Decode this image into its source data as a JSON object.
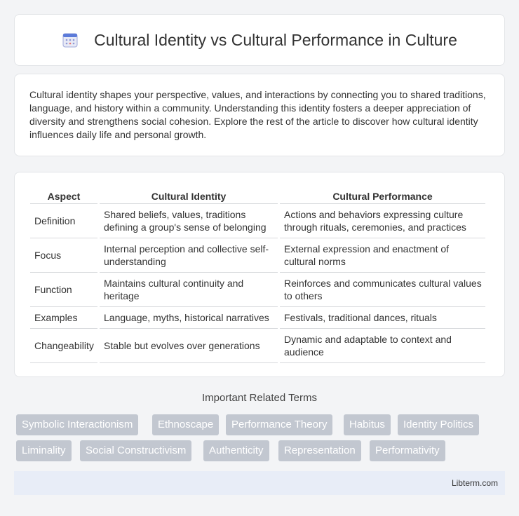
{
  "header": {
    "title": "Cultural Identity vs Cultural Performance in Culture",
    "icon": "calendar-icon"
  },
  "intro": {
    "text": "Cultural identity shapes your perspective, values, and interactions by connecting you to shared traditions, language, and history within a community. Understanding this identity fosters a deeper appreciation of diversity and strengthens social cohesion. Explore the rest of the article to discover how cultural identity influences daily life and personal growth."
  },
  "table": {
    "headers": [
      "Aspect",
      "Cultural Identity",
      "Cultural Performance"
    ],
    "rows": [
      [
        "Definition",
        "Shared beliefs, values, traditions defining a group's sense of belonging",
        "Actions and behaviors expressing culture through rituals, ceremonies, and practices"
      ],
      [
        "Focus",
        "Internal perception and collective self-understanding",
        "External expression and enactment of cultural norms"
      ],
      [
        "Function",
        "Maintains cultural continuity and heritage",
        "Reinforces and communicates cultural values to others"
      ],
      [
        "Examples",
        "Language, myths, historical narratives",
        "Festivals, traditional dances, rituals"
      ],
      [
        "Changeability",
        "Stable but evolves over generations",
        "Dynamic and adaptable to context and audience"
      ]
    ]
  },
  "related": {
    "title": "Important Related Terms",
    "tags": [
      "Symbolic Interactionism",
      "Ethnoscape",
      "Performance Theory",
      "Habitus",
      "Identity Politics",
      "Liminality",
      "Social Constructivism",
      "Authenticity",
      "Representation",
      "Performativity"
    ]
  },
  "footer": {
    "brand": "Libterm.com"
  },
  "colors": {
    "tag_bg": "#c2c7d0",
    "footer_bg": "#e8edf7",
    "page_bg": "#f3f4f6"
  }
}
